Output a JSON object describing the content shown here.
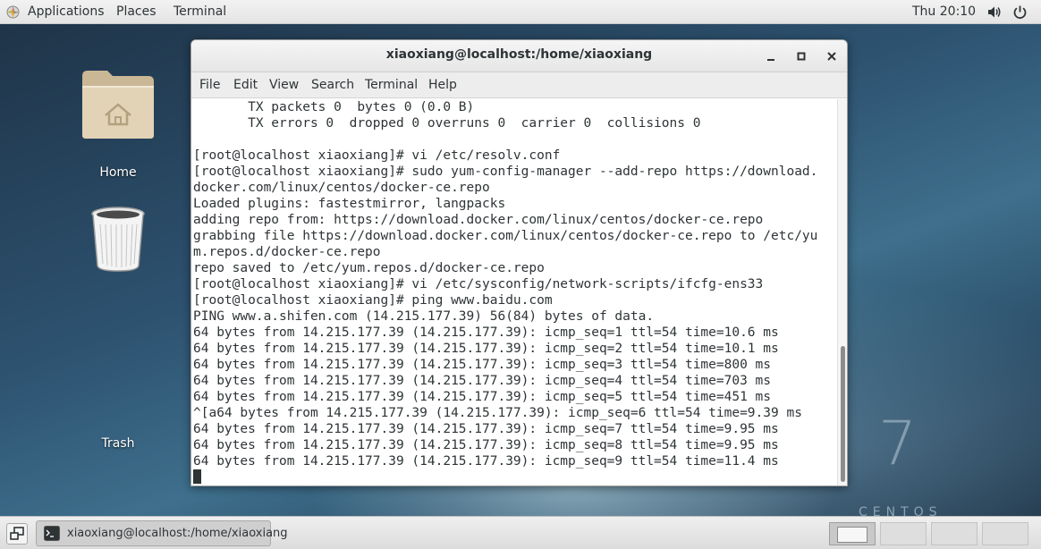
{
  "topbar": {
    "applications": "Applications",
    "places": "Places",
    "terminal": "Terminal",
    "clock": "Thu 20:10"
  },
  "desktop": {
    "home_label": "Home",
    "trash_label": "Trash",
    "centos_number": "7",
    "centos_word": "CENTOS"
  },
  "window": {
    "title": "xiaoxiang@localhost:/home/xiaoxiang",
    "menu": [
      "File",
      "Edit",
      "View",
      "Search",
      "Terminal",
      "Help"
    ],
    "lines": [
      "       TX packets 0  bytes 0 (0.0 B)",
      "       TX errors 0  dropped 0 overruns 0  carrier 0  collisions 0",
      "",
      "[root@localhost xiaoxiang]# vi /etc/resolv.conf",
      "[root@localhost xiaoxiang]# sudo yum-config-manager --add-repo https://download.",
      "docker.com/linux/centos/docker-ce.repo",
      "Loaded plugins: fastestmirror, langpacks",
      "adding repo from: https://download.docker.com/linux/centos/docker-ce.repo",
      "grabbing file https://download.docker.com/linux/centos/docker-ce.repo to /etc/yu",
      "m.repos.d/docker-ce.repo",
      "repo saved to /etc/yum.repos.d/docker-ce.repo",
      "[root@localhost xiaoxiang]# vi /etc/sysconfig/network-scripts/ifcfg-ens33",
      "[root@localhost xiaoxiang]# ping www.baidu.com",
      "PING www.a.shifen.com (14.215.177.39) 56(84) bytes of data.",
      "64 bytes from 14.215.177.39 (14.215.177.39): icmp_seq=1 ttl=54 time=10.6 ms",
      "64 bytes from 14.215.177.39 (14.215.177.39): icmp_seq=2 ttl=54 time=10.1 ms",
      "64 bytes from 14.215.177.39 (14.215.177.39): icmp_seq=3 ttl=54 time=800 ms",
      "64 bytes from 14.215.177.39 (14.215.177.39): icmp_seq=4 ttl=54 time=703 ms",
      "64 bytes from 14.215.177.39 (14.215.177.39): icmp_seq=5 ttl=54 time=451 ms",
      "^[a64 bytes from 14.215.177.39 (14.215.177.39): icmp_seq=6 ttl=54 time=9.39 ms",
      "64 bytes from 14.215.177.39 (14.215.177.39): icmp_seq=7 ttl=54 time=9.95 ms",
      "64 bytes from 14.215.177.39 (14.215.177.39): icmp_seq=8 ttl=54 time=9.95 ms",
      "64 bytes from 14.215.177.39 (14.215.177.39): icmp_seq=9 ttl=54 time=11.4 ms"
    ]
  },
  "taskbar": {
    "task_label": "xiaoxiang@localhost:/home/xiaoxiang"
  },
  "icons": {
    "apps": "apps-icon",
    "volume": "volume-icon",
    "power": "power-icon",
    "home_folder": "home-folder-icon",
    "trash": "trash-icon",
    "minimize": "minimize-icon",
    "maximize": "maximize-icon",
    "close": "close-icon",
    "show_desktop": "show-desktop-icon",
    "terminal": "terminal-icon"
  }
}
